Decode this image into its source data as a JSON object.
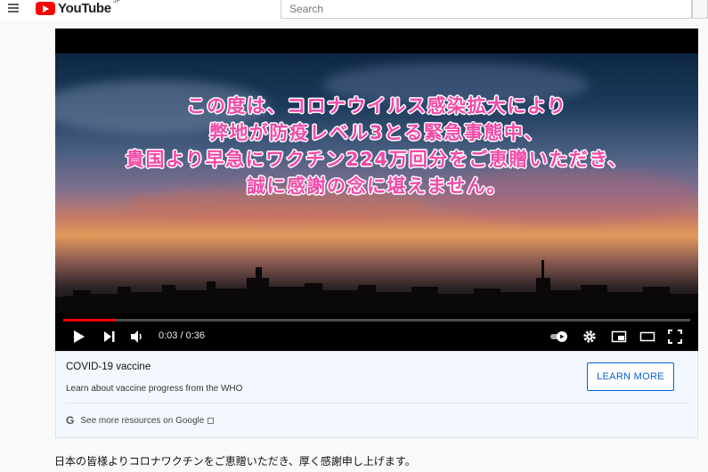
{
  "header": {
    "logo_text": "YouTube",
    "logo_country": "JP",
    "search_placeholder": "Search"
  },
  "video": {
    "caption_lines": [
      "この度は、コロナウイルス感染拡大により",
      "弊地が防疫レベル3とる緊急事態中、",
      "貴国より早急にワクチン224万回分をご恵贈いただき、",
      "誠に感謝の念に堪えません。"
    ],
    "caption_color": "#f24aa8",
    "time_display": "0:03 / 0:36",
    "progress_fraction": 0.083
  },
  "info_card": {
    "title": "COVID-19 vaccine",
    "description": "Learn about vaccine progress from the WHO",
    "button_label": "LEARN MORE",
    "google_letter": "G",
    "google_link": "See more resources on Google"
  },
  "description_text": "日本の皆様よりコロナワクチンをご恵贈いただき、厚く感謝申し上げます。",
  "colors": {
    "accent_red": "#ff0000",
    "link_blue": "#065fd4"
  }
}
